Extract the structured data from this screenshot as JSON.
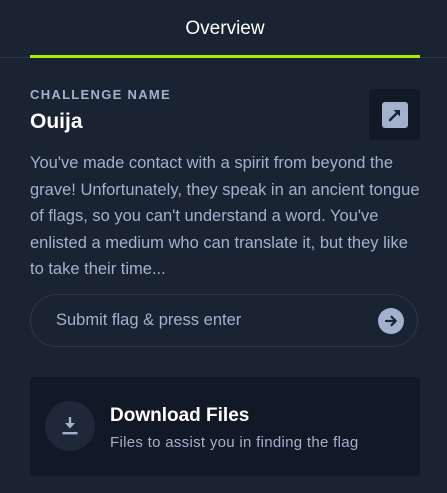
{
  "tabs": {
    "overview_label": "Overview"
  },
  "challenge": {
    "caption": "CHALLENGE NAME",
    "name": "Ouija",
    "description": "You've made contact with a spirit from beyond the grave! Unfortunately, they speak in an ancient tongue of flags, so you can't understand a word. You've enlisted a medium who can translate it, but they like to take their time..."
  },
  "flag": {
    "placeholder": "Submit flag & press enter",
    "value": ""
  },
  "download": {
    "title": "Download Files",
    "subtitle": "Files to assist you in finding the flag"
  },
  "icons": {
    "external": "external-link-icon",
    "submit": "arrow-right-icon",
    "download": "download-icon"
  },
  "colors": {
    "background": "#1a2332",
    "card": "#111927",
    "accent": "#9fef00",
    "text_muted": "#a4b1cd",
    "text": "#ffffff"
  }
}
